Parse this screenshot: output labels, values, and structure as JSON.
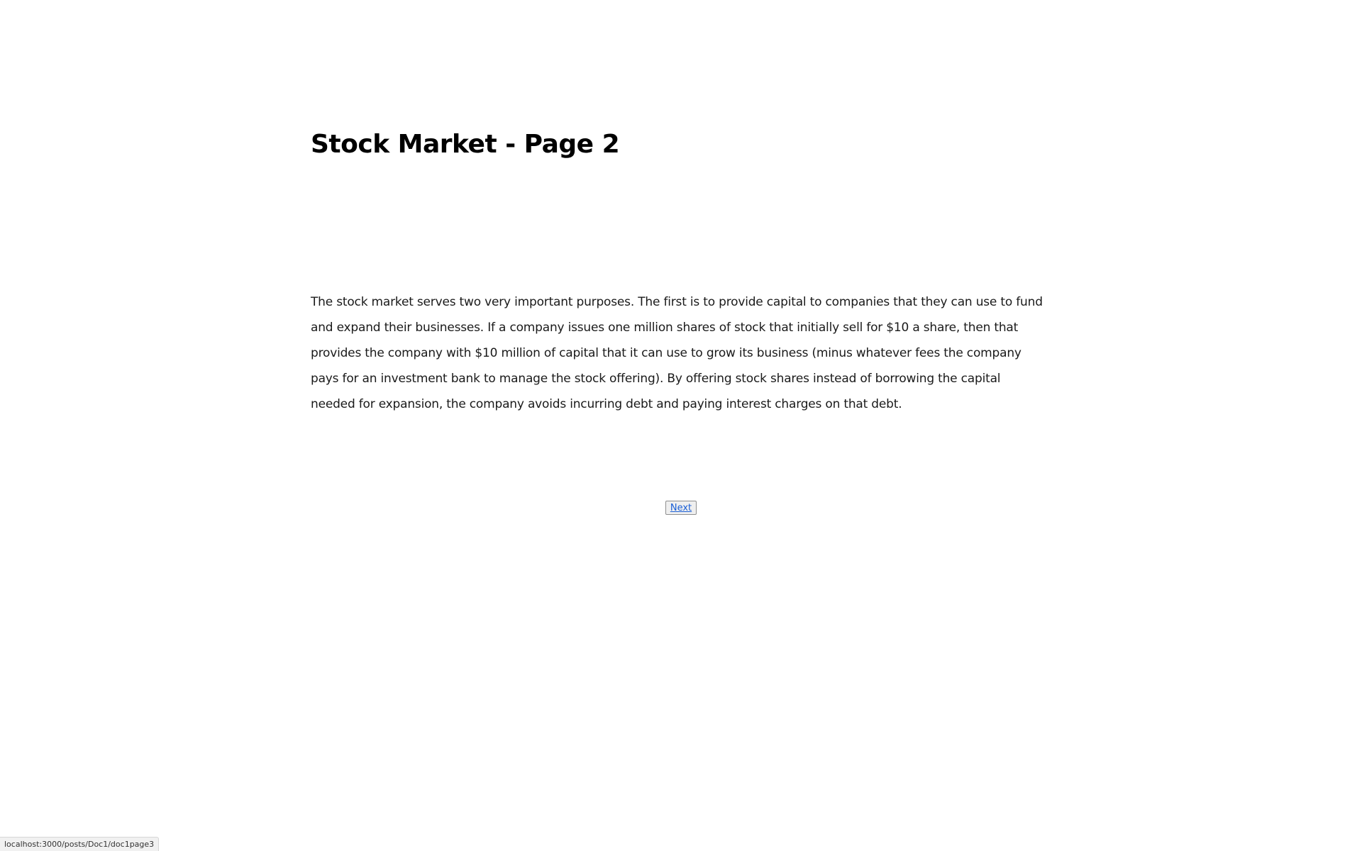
{
  "page": {
    "title": "Stock Market - Page 2",
    "paragraph": "The stock market serves two very important purposes. The first is to provide capital to companies that they can use to fund and expand their businesses. If a company issues one million shares of stock that initially sell for $10 a share, then that provides the company with $10 million of capital that it can use to grow its business (minus whatever fees the company pays for an investment bank to manage the stock offering). By offering stock shares instead of borrowing the capital needed for expansion, the company avoids incurring debt and paying interest charges on that debt."
  },
  "navigation": {
    "next_label": "Next"
  },
  "status_bar": {
    "url": "localhost:3000/posts/Doc1/doc1page3"
  },
  "colors": {
    "link": "#1a5fd6",
    "background": "#ffffff",
    "text": "#1a1a1a"
  }
}
